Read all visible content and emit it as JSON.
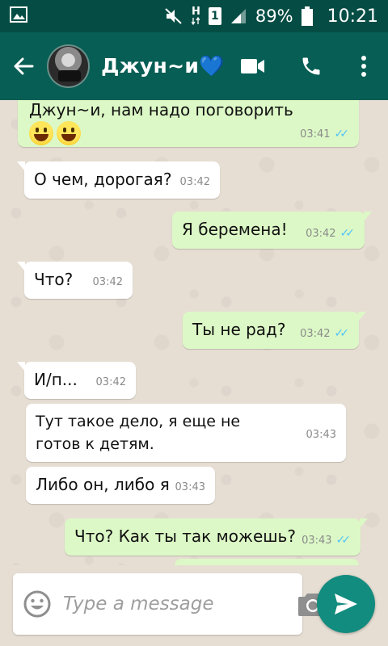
{
  "status_bar": {
    "battery": "89%",
    "time": "10:21",
    "network": "H",
    "sim": "1"
  },
  "header": {
    "contact_name": "Джун~и",
    "heart": "💙"
  },
  "messages": [
    {
      "text": "Джун~и, нам надо поговорить",
      "time": "03:41",
      "direction": "out"
    },
    {
      "text": "О чем, дорогая?",
      "time": "03:42",
      "direction": "in"
    },
    {
      "text": "Я беремена!",
      "time": "03:42",
      "direction": "out"
    },
    {
      "text": "Что?",
      "time": "03:42",
      "direction": "in"
    },
    {
      "text": "Ты не рад?",
      "time": "03:42",
      "direction": "out"
    },
    {
      "text": "И/п...",
      "time": "03:42",
      "direction": "in"
    },
    {
      "text": "Тут такое дело, я еще не готов к детям.",
      "time": "03:43",
      "direction": "in"
    },
    {
      "text": "Либо он, либо я",
      "time": "03:43",
      "direction": "in"
    },
    {
      "text": "Что? Как ты так можешь?",
      "time": "03:43",
      "direction": "out"
    }
  ],
  "composer": {
    "placeholder": "Type a message"
  },
  "colors": {
    "header": "#075e54",
    "status_bar": "#054d44",
    "outgoing_bubble": "#dcf8c6",
    "incoming_bubble": "#ffffff",
    "send_button": "#128c7e",
    "read_ticks": "#4fc3f7"
  }
}
